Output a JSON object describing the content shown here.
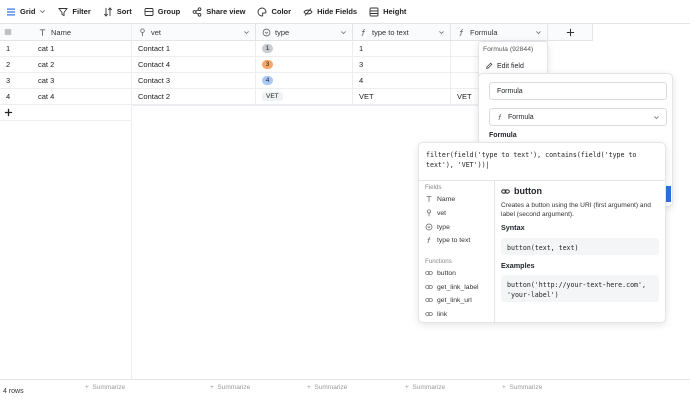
{
  "toolbar": {
    "grid_label": "Grid",
    "filter_label": "Filter",
    "sort_label": "Sort",
    "group_label": "Group",
    "share_label": "Share view",
    "color_label": "Color",
    "hide_label": "Hide Fields",
    "height_label": "Height"
  },
  "columns": [
    {
      "label": "Name",
      "icon": "text-icon"
    },
    {
      "label": "vet",
      "icon": "link-icon"
    },
    {
      "label": "type",
      "icon": "single-select-icon"
    },
    {
      "label": "type to text",
      "icon": "formula-icon"
    },
    {
      "label": "Formula",
      "icon": "formula-icon"
    }
  ],
  "rows": [
    {
      "num": "1",
      "name": "cat 1",
      "vet": "Contact 1",
      "type": "1",
      "type_color": "#c9cbd0",
      "ttt": "1",
      "formula": ""
    },
    {
      "num": "2",
      "name": "cat 2",
      "vet": "Contact 4",
      "type": "3",
      "type_color": "#f5a86a",
      "ttt": "3",
      "formula": ""
    },
    {
      "num": "3",
      "name": "cat 3",
      "vet": "Contact 3",
      "type": "4",
      "type_color": "#a9c8f6",
      "ttt": "4",
      "formula": ""
    },
    {
      "num": "4",
      "name": "cat 4",
      "vet": "Contact 2",
      "type": "VET",
      "type_color": "#f0f1f4",
      "ttt": "VET",
      "formula": "VET"
    }
  ],
  "footer": {
    "rows_count": "4 rows",
    "summarize": "Summarize"
  },
  "field_menu": {
    "title": "Formula (92844)",
    "edit_field": "Edit field"
  },
  "field_editor": {
    "name_value": "Formula",
    "type_value": "Formula",
    "formula_label": "Formula"
  },
  "formula_popup": {
    "expression": "filter(field('type to text'), contains(field('type to text'), 'VET'))|",
    "fields_heading": "Fields",
    "fields": [
      "Name",
      "vet",
      "type",
      "type to text"
    ],
    "functions_heading": "Functions",
    "functions": [
      "button",
      "get_link_label",
      "get_link_url",
      "link"
    ],
    "doc": {
      "title": "button",
      "description": "Creates a button using the URI (first argument) and label (second argument).",
      "syntax_heading": "Syntax",
      "syntax": "button(text, text)",
      "examples_heading": "Examples",
      "example_line1": "button('http://your-text-here.com',",
      "example_line2": "'your-label')"
    }
  },
  "colors": {
    "accent": "#2f6fe0",
    "border": "#e3e5e8"
  }
}
